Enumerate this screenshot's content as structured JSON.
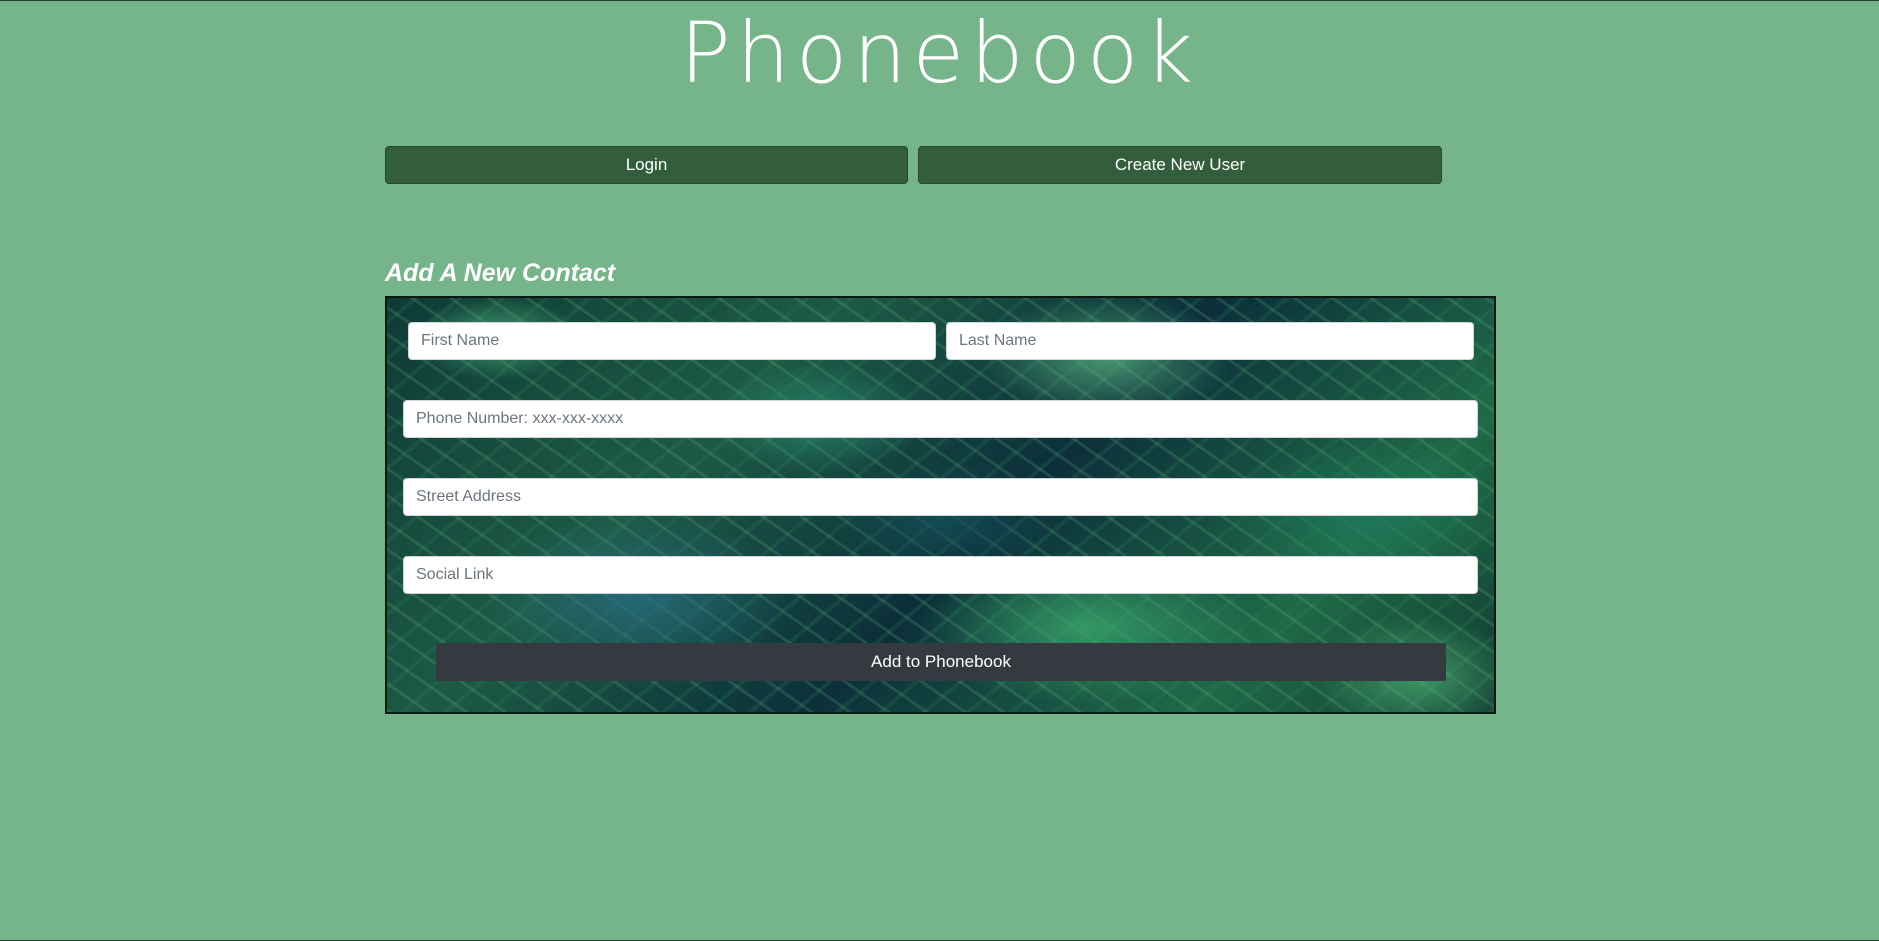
{
  "header": {
    "title": "Phonebook"
  },
  "auth": {
    "login_label": "Login",
    "create_user_label": "Create New User"
  },
  "contact_form": {
    "heading": "Add A New Contact",
    "first_name": {
      "placeholder": "First Name",
      "value": ""
    },
    "last_name": {
      "placeholder": "Last Name",
      "value": ""
    },
    "phone": {
      "placeholder": "Phone Number: xxx-xxx-xxxx",
      "value": ""
    },
    "street": {
      "placeholder": "Street Address",
      "value": ""
    },
    "social": {
      "placeholder": "Social Link",
      "value": ""
    },
    "submit_label": "Add to Phonebook"
  },
  "colors": {
    "page_background": "#76b589",
    "auth_button": "#335e3b",
    "submit_button": "#343a40",
    "text_light": "#ffffff"
  },
  "icons": {
    "form_background": "tropical-leaves-image"
  }
}
